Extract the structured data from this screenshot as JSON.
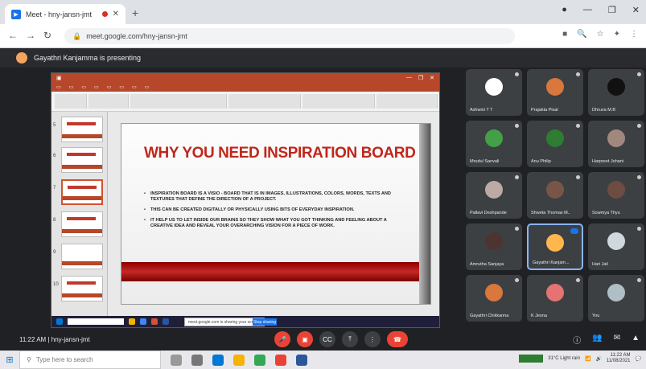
{
  "browser": {
    "tab_title": "Meet - hny-jansn-jmt",
    "url": "meet.google.com/hny-jansn-jmt"
  },
  "meet": {
    "presenter_banner": "Gayathri Kanjamma is presenting",
    "clock": "11:22 AM",
    "meeting_code": "hny-jansn-jmt"
  },
  "slide": {
    "title": "WHY YOU NEED INSPIRATION BOARD",
    "bullets": [
      "INSPIRATION BOARD IS A VISIO - BOARD THAT IS IN IMAGES, ILLUSTRATIONS, COLORS, WORDS, TEXTS AND TEXTURES THAT DEFINE THE DIRECTION OF A PROJECT.",
      "THIS CAN BE CREATED DIGITALLY OR PHYSICALLY USING BITS OF EVERYDAY INSPIRATION.",
      "IT HELP US TO LET INSIDE OUR BRAINS SO THEY SHOW WHAT YOU GOT THINKING AND FEELING ABOUT A CREATIVE IDEA AND REVEAL YOUR OVERARCHING VISION FOR A PIECE OF WORK."
    ]
  },
  "share_controls": {
    "banner": "meet.google.com is sharing your screen",
    "stop": "Stop sharing"
  },
  "participants": [
    {
      "name": "Ashwini T T",
      "color": "#ffffff"
    },
    {
      "name": "Prajakta Pisal",
      "color": "#d9773c"
    },
    {
      "name": "Dhruva M.B",
      "color": "#111111"
    },
    {
      "name": "Mrudul Sanvali",
      "color": "#43a047"
    },
    {
      "name": "Anu Philip",
      "color": "#2e7d32"
    },
    {
      "name": "Harpreet Johani",
      "color": "#a1887f"
    },
    {
      "name": "Pallavi Deshpande",
      "color": "#bcaaa4"
    },
    {
      "name": "Shweta Thomas M..",
      "color": "#795548"
    },
    {
      "name": "Sowmya Thyu",
      "color": "#6d4c41"
    },
    {
      "name": "Amrutha Sanjaya",
      "color": "#4e342e"
    },
    {
      "name": "Gayathri Kanjam...",
      "color": "#ffb74d"
    },
    {
      "name": "Hari Jali",
      "color": "#cfd8dc"
    },
    {
      "name": "Gayathri Chikkanna",
      "color": "#d9773c"
    },
    {
      "name": "K Jesna",
      "color": "#e57373"
    },
    {
      "name": "You",
      "color": "#b0bec5"
    }
  ],
  "taskbar": {
    "search_placeholder": "Type here to search",
    "weather": "31°C  Light rain",
    "time": "11:22 AM",
    "date": "11/08/2021"
  }
}
